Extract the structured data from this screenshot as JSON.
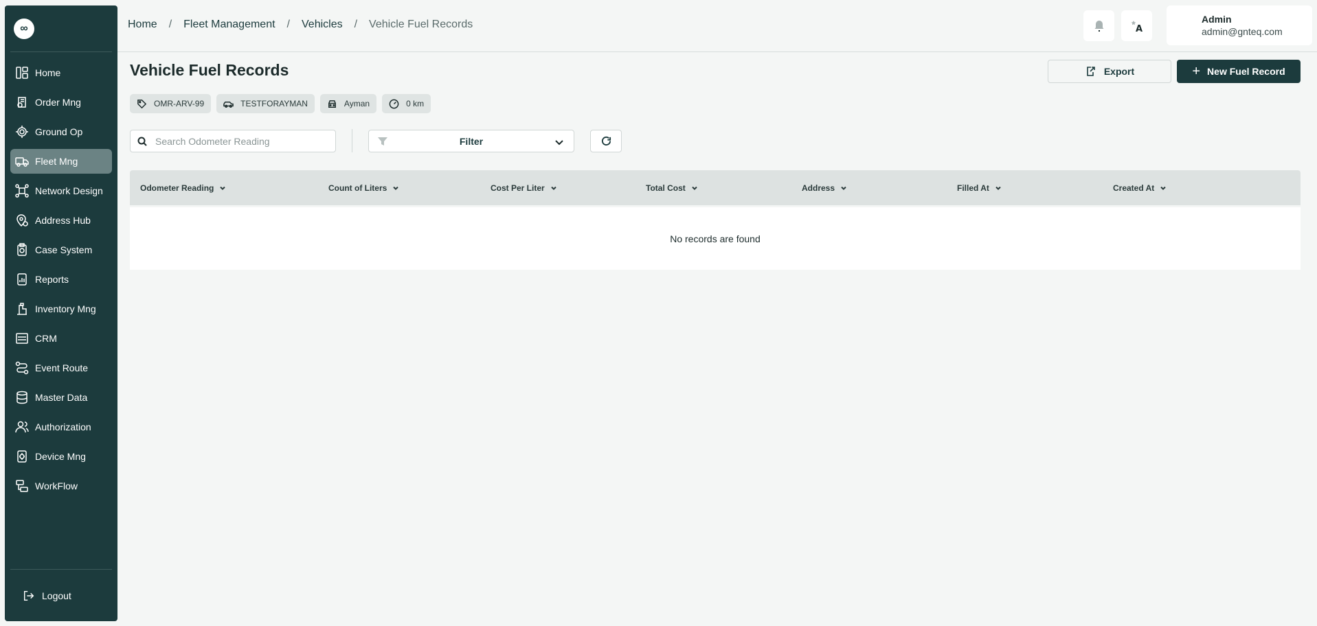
{
  "sidebar": {
    "logo": "∞",
    "items": [
      {
        "label": "Home",
        "icon": "home-icon"
      },
      {
        "label": "Order Mng",
        "icon": "order-icon"
      },
      {
        "label": "Ground Op",
        "icon": "ground-op-icon"
      },
      {
        "label": "Fleet Mng",
        "icon": "truck-icon",
        "active": true
      },
      {
        "label": "Network Design",
        "icon": "network-icon"
      },
      {
        "label": "Address Hub",
        "icon": "location-icon"
      },
      {
        "label": "Case System",
        "icon": "case-icon"
      },
      {
        "label": "Reports",
        "icon": "reports-icon"
      },
      {
        "label": "Inventory Mng",
        "icon": "inventory-icon"
      },
      {
        "label": "CRM",
        "icon": "crm-icon"
      },
      {
        "label": "Event Route",
        "icon": "route-icon"
      },
      {
        "label": "Master Data",
        "icon": "database-icon"
      },
      {
        "label": "Authorization",
        "icon": "users-icon"
      },
      {
        "label": "Device Mng",
        "icon": "device-icon"
      },
      {
        "label": "WorkFlow",
        "icon": "workflow-icon"
      }
    ],
    "logout": "Logout"
  },
  "header": {
    "breadcrumb": [
      "Home",
      "Fleet Management",
      "Vehicles",
      "Vehicle Fuel Records"
    ],
    "user": {
      "name": "Admin",
      "email": "admin@gnteq.com"
    }
  },
  "main": {
    "title": "Vehicle Fuel Records",
    "export_label": "Export",
    "new_label": "New Fuel Record",
    "chips": [
      {
        "label": "OMR-ARV-99",
        "icon": "tag-icon"
      },
      {
        "label": "TESTFORAYMAN",
        "icon": "car-icon"
      },
      {
        "label": "Ayman",
        "icon": "car-front-icon"
      },
      {
        "label": "0 km",
        "icon": "speedometer-icon"
      }
    ],
    "search_placeholder": "Search Odometer Reading",
    "filter_label": "Filter",
    "columns": [
      "Odometer Reading",
      "Count of Liters",
      "Cost Per Liter",
      "Total Cost",
      "Address",
      "Filled At",
      "Created At"
    ],
    "empty_message": "No records are found"
  }
}
